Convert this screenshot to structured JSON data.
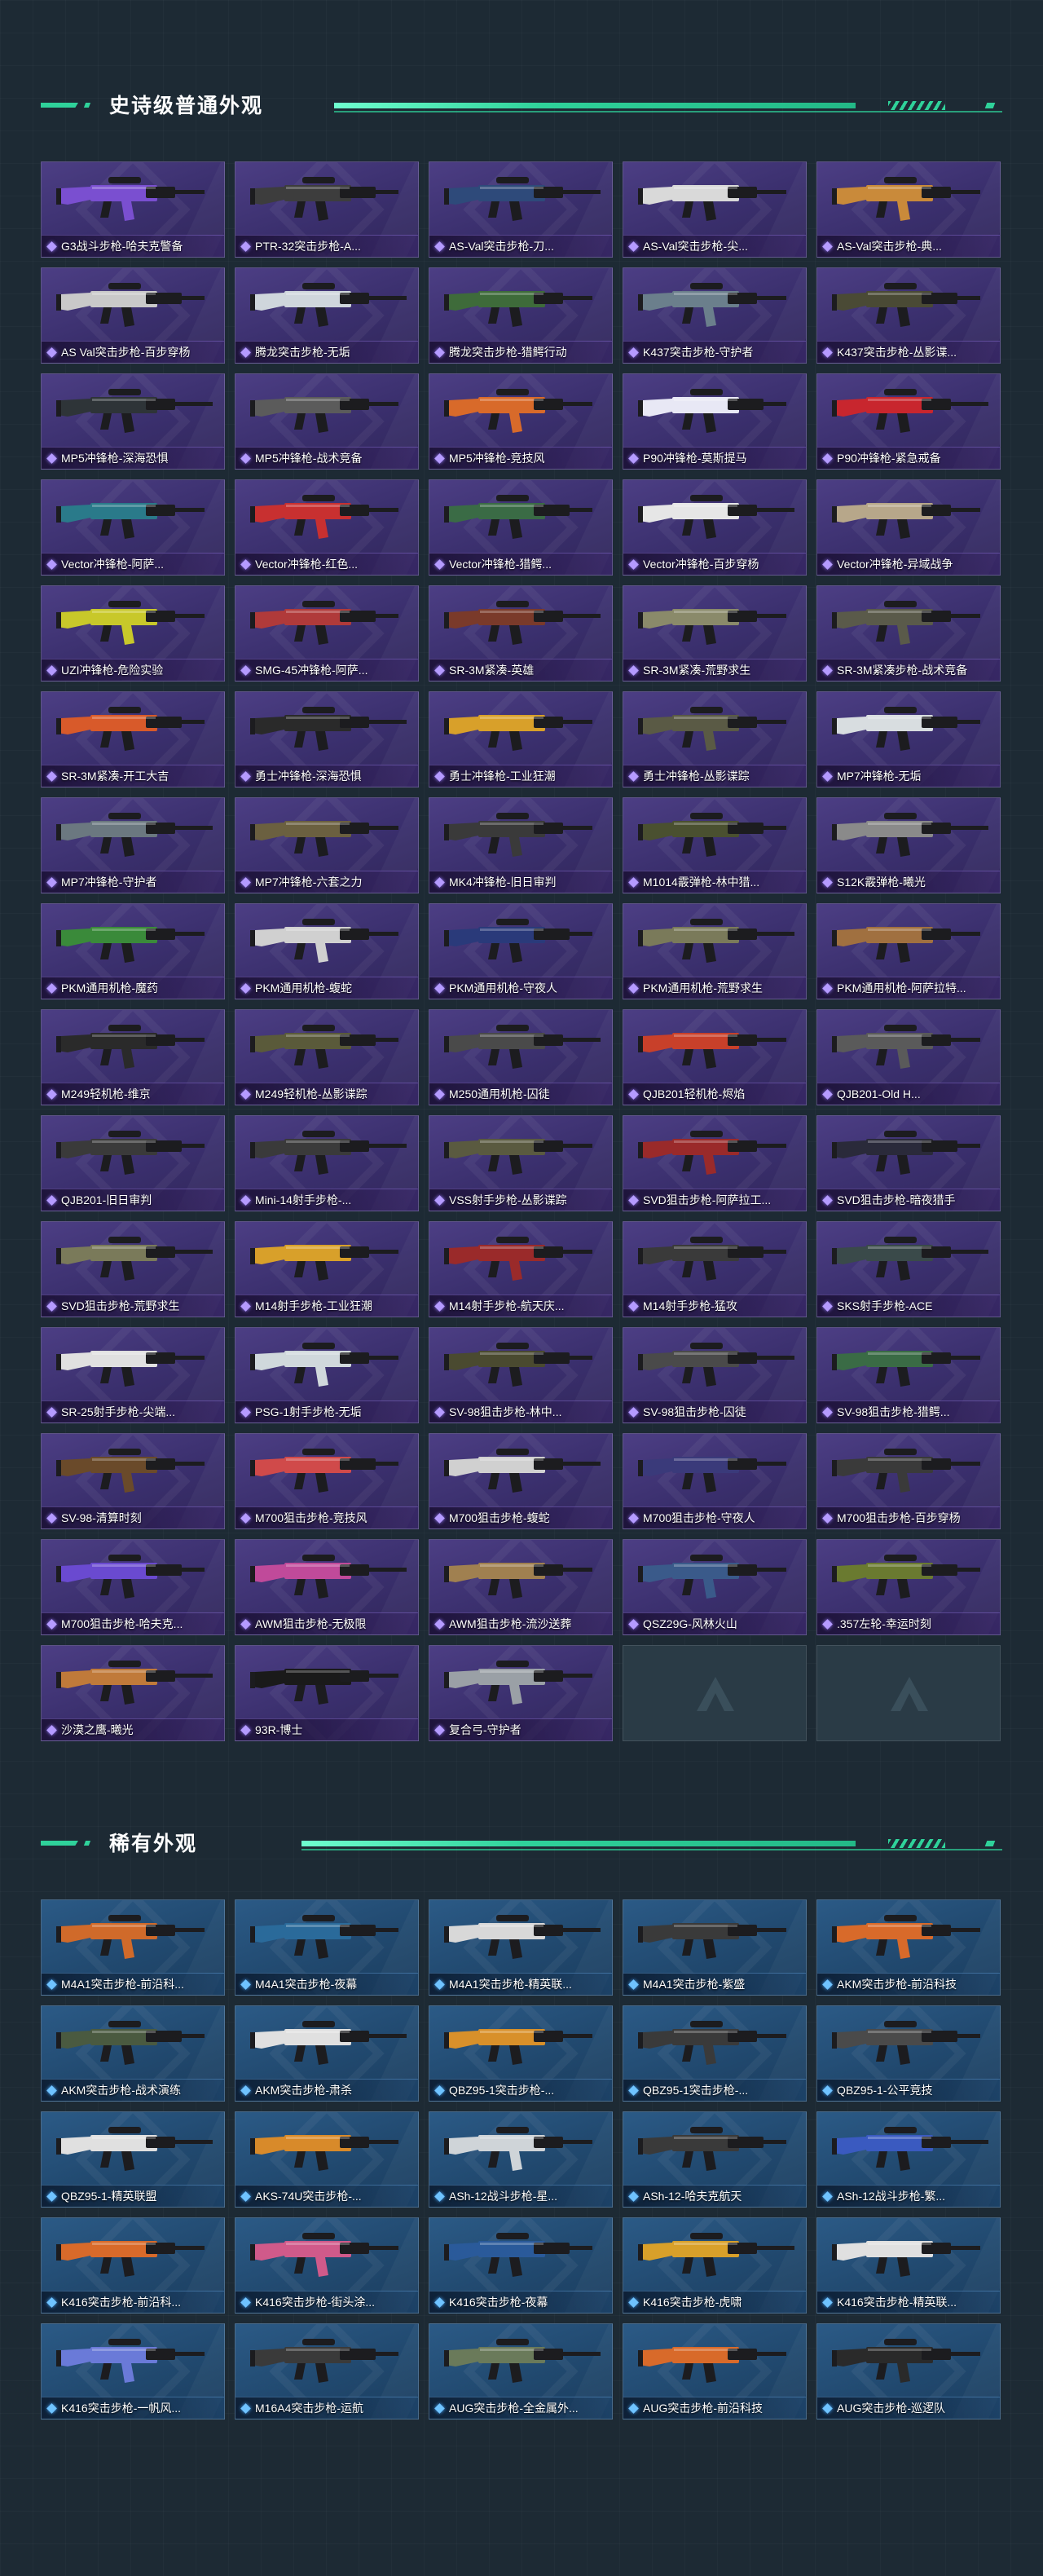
{
  "colors": {
    "accent": "#2fd29a",
    "epic": "#3d3173",
    "rare": "#21496f",
    "background": "#1d2a34"
  },
  "sections": {
    "epic": {
      "title": "史诗级普通外观",
      "items": [
        {
          "name": "G3战斗步枪-哈夫克警备",
          "accent": "#7a4fd0"
        },
        {
          "name": "PTR-32突击步枪-A...",
          "accent": "#3d3d3d"
        },
        {
          "name": "AS-Val突击步枪-刀...",
          "accent": "#2e4a7a"
        },
        {
          "name": "AS-Val突击步枪-尖...",
          "accent": "#d9d9d9"
        },
        {
          "name": "AS-Val突击步枪-典...",
          "accent": "#c98a3a"
        },
        {
          "name": "AS Val突击步枪-百步穿杨",
          "accent": "#c9c9c9"
        },
        {
          "name": "腾龙突击步枪-无垢",
          "accent": "#cfd6dc"
        },
        {
          "name": "腾龙突击步枪-猎鳄行动",
          "accent": "#3e6b3a"
        },
        {
          "name": "K437突击步枪-守护者",
          "accent": "#6b7f8c"
        },
        {
          "name": "K437突击步枪-丛影谍...",
          "accent": "#4a4a35"
        },
        {
          "name": "MP5冲锋枪-深海恐惧",
          "accent": "#2e3438"
        },
        {
          "name": "MP5冲锋枪-战术竞备",
          "accent": "#5b5b5b"
        },
        {
          "name": "MP5冲锋枪-竞技风",
          "accent": "#d86a2a"
        },
        {
          "name": "P90冲锋枪-莫斯提马",
          "accent": "#e8e8f5"
        },
        {
          "name": "P90冲锋枪-紧急戒备",
          "accent": "#c8262e"
        },
        {
          "name": "Vector冲锋枪-阿萨...",
          "accent": "#2a7a8a"
        },
        {
          "name": "Vector冲锋枪-红色...",
          "accent": "#c83030"
        },
        {
          "name": "Vector冲锋枪-猎鳄...",
          "accent": "#3a6b45"
        },
        {
          "name": "Vector冲锋枪-百步穿杨",
          "accent": "#e6e6e6"
        },
        {
          "name": "Vector冲锋枪-异域战争",
          "accent": "#b7a78a"
        },
        {
          "name": "UZI冲锋枪-危险实验",
          "accent": "#c8c82a"
        },
        {
          "name": "SMG-45冲锋枪-阿萨...",
          "accent": "#b03a3a"
        },
        {
          "name": "SR-3M紧凑-英雄",
          "accent": "#7a3a2a"
        },
        {
          "name": "SR-3M紧凑-荒野求生",
          "accent": "#8a8a6a"
        },
        {
          "name": "SR-3M紧凑步枪-战术竞备",
          "accent": "#5a5a4a"
        },
        {
          "name": "SR-3M紧凑-开工大吉",
          "accent": "#d85a2a"
        },
        {
          "name": "勇士冲锋枪-深海恐惧",
          "accent": "#2a2a2a"
        },
        {
          "name": "勇士冲锋枪-工业狂潮",
          "accent": "#d8a02a"
        },
        {
          "name": "勇士冲锋枪-丛影谍踪",
          "accent": "#5a5a45"
        },
        {
          "name": "MP7冲锋枪-无垢",
          "accent": "#d8dde0"
        },
        {
          "name": "MP7冲锋枪-守护者",
          "accent": "#6b7880"
        },
        {
          "name": "MP7冲锋枪-六套之力",
          "accent": "#6b6040"
        },
        {
          "name": "MK4冲锋枪-旧日审判",
          "accent": "#3a3a3a"
        },
        {
          "name": "M1014霰弹枪-林中猎...",
          "accent": "#4a5030"
        },
        {
          "name": "S12K霰弹枪-曦光",
          "accent": "#8a8a8a"
        },
        {
          "name": "PKM通用机枪-魔药",
          "accent": "#3a8a3a"
        },
        {
          "name": "PKM通用机枪-蝮蛇",
          "accent": "#d0d0d0"
        },
        {
          "name": "PKM通用机枪-守夜人",
          "accent": "#2a3a7a"
        },
        {
          "name": "PKM通用机枪-荒野求生",
          "accent": "#7a7a5a"
        },
        {
          "name": "PKM通用机枪-阿萨拉特...",
          "accent": "#a07040"
        },
        {
          "name": "M249轻机枪-维京",
          "accent": "#2a2a2a"
        },
        {
          "name": "M249轻机枪-丛影谍踪",
          "accent": "#5a5a3a"
        },
        {
          "name": "M250通用机枪-囚徒",
          "accent": "#4a4a4a"
        },
        {
          "name": "QJB201轻机枪-烬焰",
          "accent": "#c8402a"
        },
        {
          "name": "QJB201-Old H...",
          "accent": "#5a5a5a"
        },
        {
          "name": "QJB201-旧日审判",
          "accent": "#3a3a3a"
        },
        {
          "name": "Mini-14射手步枪-...",
          "accent": "#3a3a3a"
        },
        {
          "name": "VSS射手步枪-丛影谍踪",
          "accent": "#5a5a40"
        },
        {
          "name": "SVD狙击步枪-阿萨拉工...",
          "accent": "#9a2a2a"
        },
        {
          "name": "SVD狙击步枪-暗夜猎手",
          "accent": "#2a2a3a"
        },
        {
          "name": "SVD狙击步枪-荒野求生",
          "accent": "#7a7a5a"
        },
        {
          "name": "M14射手步枪-工业狂潮",
          "accent": "#d8a02a"
        },
        {
          "name": "M14射手步枪-航天庆...",
          "accent": "#9a2a2a"
        },
        {
          "name": "M14射手步枪-猛攻",
          "accent": "#3a3a3a"
        },
        {
          "name": "SKS射手步枪-ACE",
          "accent": "#3a4a4a"
        },
        {
          "name": "SR-25射手步枪-尖端...",
          "accent": "#e0e0e0"
        },
        {
          "name": "PSG-1射手步枪-无垢",
          "accent": "#d0d8dc"
        },
        {
          "name": "SV-98狙击步枪-林中...",
          "accent": "#4a4a30"
        },
        {
          "name": "SV-98狙击步枪-囚徒",
          "accent": "#4a4a4a"
        },
        {
          "name": "SV-98狙击步枪-猎鳄...",
          "accent": "#3a6b45"
        },
        {
          "name": "SV-98-清算时刻",
          "accent": "#6a4a2a"
        },
        {
          "name": "M700狙击步枪-竞技风",
          "accent": "#d04a4a"
        },
        {
          "name": "M700狙击步枪-蝮蛇",
          "accent": "#d0d0d0"
        },
        {
          "name": "M700狙击步枪-守夜人",
          "accent": "#3a3a7a"
        },
        {
          "name": "M700狙击步枪-百步穿杨",
          "accent": "#3a3a3a"
        },
        {
          "name": "M700狙击步枪-哈夫克...",
          "accent": "#6a4ad0"
        },
        {
          "name": "AWM狙击步枪-无极限",
          "accent": "#c04a9a"
        },
        {
          "name": "AWM狙击步枪-流沙送葬",
          "accent": "#a08050"
        },
        {
          "name": "QSZ29G-风林火山",
          "accent": "#3a5a8a"
        },
        {
          "name": ".357左轮-幸运时刻",
          "accent": "#6a7a30"
        },
        {
          "name": "沙漠之鹰-曦光",
          "accent": "#c07a3a"
        },
        {
          "name": "93R-博士",
          "accent": "#1a1a1a"
        },
        {
          "name": "复合弓-守护者",
          "accent": "#9aa0a6"
        }
      ],
      "empty_slots": 2
    },
    "rare": {
      "title": "稀有外观",
      "items": [
        {
          "name": "M4A1突击步枪-前沿科...",
          "accent": "#d06a2a"
        },
        {
          "name": "M4A1突击步枪-夜幕",
          "accent": "#2a6a9a"
        },
        {
          "name": "M4A1突击步枪-精英联...",
          "accent": "#d8d8d8"
        },
        {
          "name": "M4A1突击步枪-紫盛",
          "accent": "#3a3a3a"
        },
        {
          "name": "AKM突击步枪-前沿科技",
          "accent": "#d86a2a"
        },
        {
          "name": "AKM突击步枪-战术演练",
          "accent": "#4a5a40"
        },
        {
          "name": "AKM突击步枪-肃杀",
          "accent": "#e0e0e0"
        },
        {
          "name": "QBZ95-1突击步枪-...",
          "accent": "#d8902a"
        },
        {
          "name": "QBZ95-1突击步枪-...",
          "accent": "#3a3a3a"
        },
        {
          "name": "QBZ95-1-公平竞技",
          "accent": "#4a4a4a"
        },
        {
          "name": "QBZ95-1-精英联盟",
          "accent": "#e0e0e0"
        },
        {
          "name": "AKS-74U突击步枪-...",
          "accent": "#d88a2a"
        },
        {
          "name": "ASh-12战斗步枪-星...",
          "accent": "#cfd4d8"
        },
        {
          "name": "ASh-12-哈夫克航天",
          "accent": "#3a3a3a"
        },
        {
          "name": "ASh-12战斗步枪-繁...",
          "accent": "#3a5ac0"
        },
        {
          "name": "K416突击步枪-前沿科...",
          "accent": "#d86a2a"
        },
        {
          "name": "K416突击步枪-街头涂...",
          "accent": "#d05a8a"
        },
        {
          "name": "K416突击步枪-夜幕",
          "accent": "#2a5a9a"
        },
        {
          "name": "K416突击步枪-虎啸",
          "accent": "#d8a02a"
        },
        {
          "name": "K416突击步枪-精英联...",
          "accent": "#e0e0e0"
        },
        {
          "name": "K416突击步枪-一帆风...",
          "accent": "#6a7ad8"
        },
        {
          "name": "M16A4突击步枪-运航",
          "accent": "#3a3a3a"
        },
        {
          "name": "AUG突击步枪-全金属外...",
          "accent": "#6a7a5a"
        },
        {
          "name": "AUG突击步枪-前沿科技",
          "accent": "#d86a2a"
        },
        {
          "name": "AUG突击步枪-巡逻队",
          "accent": "#2a2a2a"
        }
      ],
      "empty_slots": 0
    }
  }
}
